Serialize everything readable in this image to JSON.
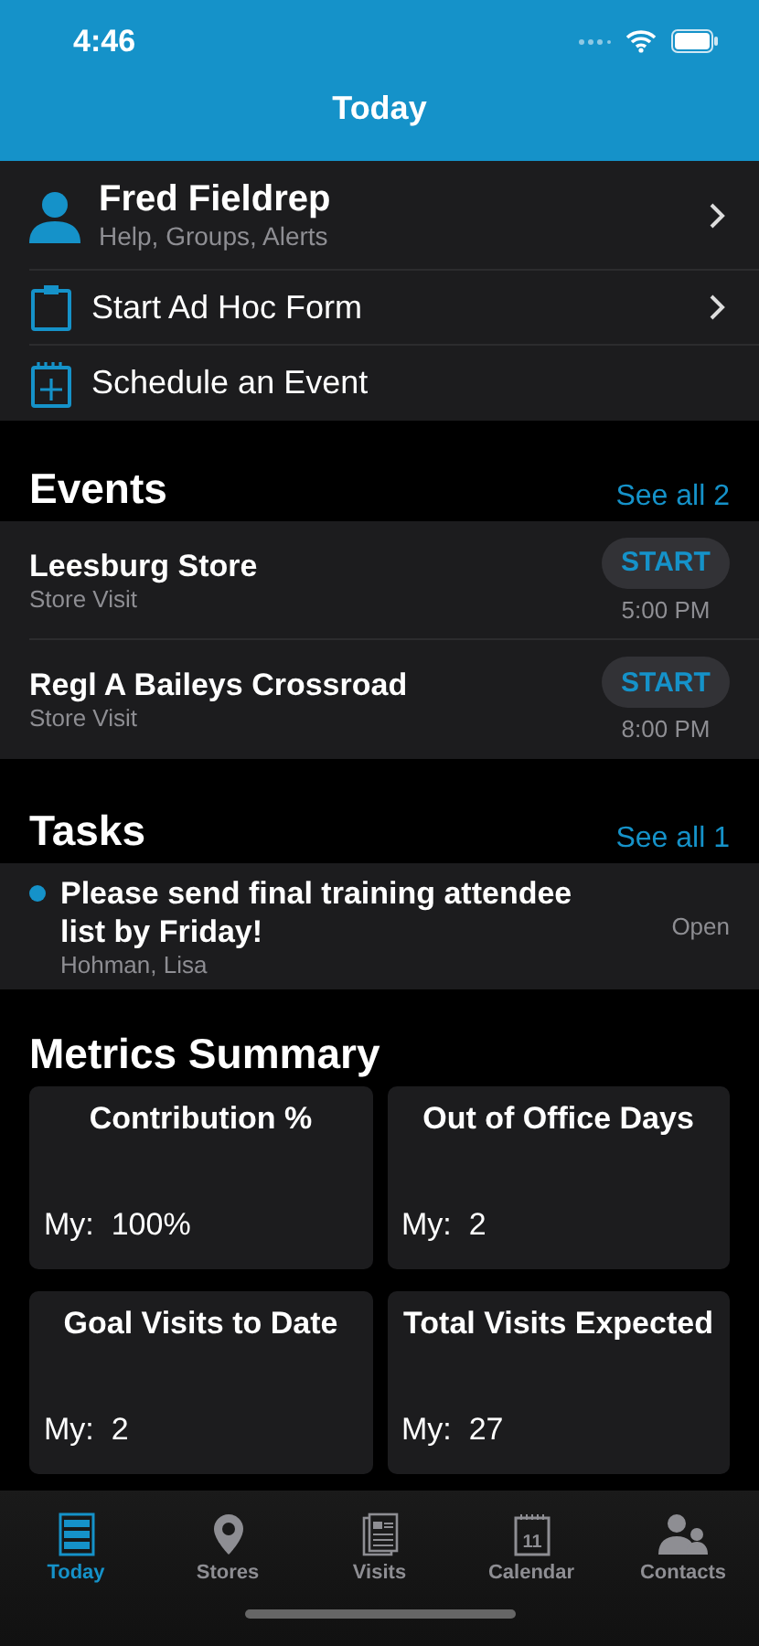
{
  "status_bar": {
    "time": "4:46"
  },
  "nav": {
    "title": "Today"
  },
  "menu": [
    {
      "kind": "profile",
      "title": "Fred Fieldrep",
      "subtitle": "Help, Groups, Alerts",
      "chevron": true
    },
    {
      "kind": "form",
      "title": "Start Ad Hoc Form",
      "chevron": true
    },
    {
      "kind": "schedule",
      "title": "Schedule an Event",
      "chevron": false
    }
  ],
  "events": {
    "title": "Events",
    "see_all": "See all 2",
    "items": [
      {
        "name": "Leesburg Store",
        "type": "Store Visit",
        "button": "START",
        "time": "5:00 PM"
      },
      {
        "name": "Regl A Baileys Crossroad",
        "type": "Store Visit",
        "button": "START",
        "time": "8:00 PM"
      }
    ]
  },
  "tasks": {
    "title": "Tasks",
    "see_all": "See all 1",
    "items": [
      {
        "title": "Please send final training attendee list by Friday!",
        "assignee": "Hohman, Lisa",
        "status": "Open",
        "unread": true
      }
    ]
  },
  "metrics": {
    "title": "Metrics Summary",
    "cards": [
      {
        "title": "Contribution %",
        "label": "My:",
        "value": "100%"
      },
      {
        "title": "Out of Office Days",
        "label": "My:",
        "value": "2"
      },
      {
        "title": "Goal Visits to Date",
        "label": "My:",
        "value": "2"
      },
      {
        "title": "Total Visits Expected",
        "label": "My:",
        "value": "27"
      }
    ]
  },
  "tab_bar": [
    {
      "kind": "today",
      "label": "Today",
      "selected": true
    },
    {
      "kind": "stores",
      "label": "Stores",
      "selected": false
    },
    {
      "kind": "visits",
      "label": "Visits",
      "selected": false
    },
    {
      "kind": "calendar",
      "label": "Calendar",
      "icon_text": "11",
      "selected": false
    },
    {
      "kind": "contacts",
      "label": "Contacts",
      "selected": false
    }
  ]
}
